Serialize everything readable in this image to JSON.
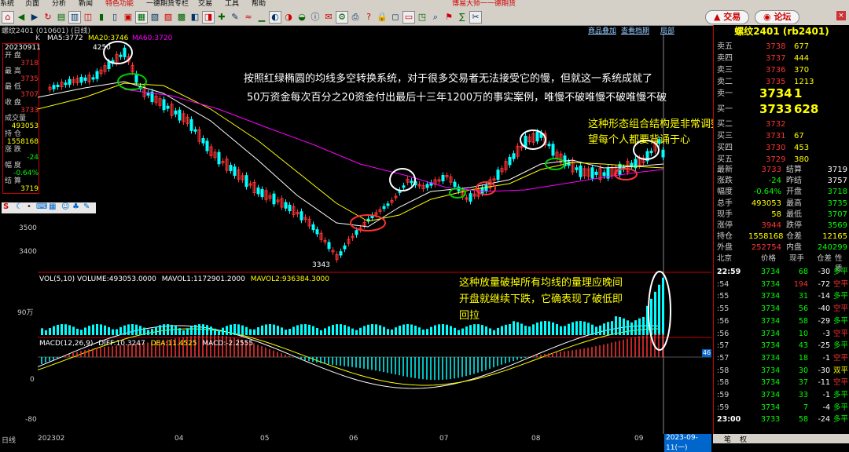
{
  "menu": {
    "items": [
      "系统",
      "页面",
      "分析",
      "新闻",
      "特色功能",
      "一德期货专栏",
      "交易",
      "工具",
      "帮助"
    ],
    "app_title": "博易大师一一德期货"
  },
  "toolbar": {
    "trade_label": "交易",
    "forum_label": "论坛",
    "icons": [
      "home-icon",
      "back-icon",
      "forward-icon",
      "refresh-icon",
      "quote-icon",
      "chart-icon",
      "minute-icon",
      "kline-icon",
      "f10-icon",
      "f11-icon",
      "grid-icon",
      "list-icon",
      "period-icon",
      "zoom-in-icon",
      "zoom-out-icon",
      "cross-icon",
      "draw-icon",
      "indicator-icon",
      "ma-icon",
      "vol-icon",
      "kdj-icon",
      "rsi-icon",
      "boll-icon",
      "info-icon",
      "news-icon",
      "settings-icon",
      "print-icon",
      "help-icon",
      "lock-icon",
      "unlock-icon",
      "window-icon",
      "split-icon",
      "search-icon",
      "alert-icon",
      "calc-icon",
      "tool-icon"
    ]
  },
  "chart_header": {
    "symbol_title": "螺纹2401 (010601) (日线)",
    "link1": "商品叠加",
    "link2": "查看档期",
    "link3": "局部"
  },
  "ma": {
    "k_label": "K",
    "ma5": "MA5:3772",
    "ma20": "MA20:3746",
    "ma60": "MA60:3720"
  },
  "left_panel": {
    "date": "20230911",
    "rows": [
      {
        "label": "开 盘",
        "value": "3718",
        "color": "red"
      },
      {
        "label": "最 高",
        "value": "3735",
        "color": "red"
      },
      {
        "label": "最 低",
        "value": "3707",
        "color": "red"
      },
      {
        "label": "收 盘",
        "value": "3733",
        "color": "red"
      },
      {
        "label": "成交量",
        "value": "493053",
        "color": "yellow"
      },
      {
        "label": "持 仓",
        "value": "1558168",
        "color": "yellow"
      },
      {
        "label": "涨 跌",
        "value": "-24",
        "color": "green"
      },
      {
        "label": "幅 度",
        "value": "-0.64%",
        "color": "green"
      },
      {
        "label": "结 算",
        "value": "3719",
        "color": "yellow"
      }
    ]
  },
  "price_axis": {
    "p1": "3500",
    "p2": "3400",
    "high_mark": "4250",
    "low_mark": "3343"
  },
  "annotations": {
    "line1": "按照红绿椭圆的均线多空转换系统，对于很多交易者无法接受它的慢，但就这一系统成就了",
    "line2": "50万资金每次百分之20资金付出最后十三年1200万的事实案例，唯慢不破唯慢不破唯慢不破",
    "pattern1": "这种形态组合结构是非常调整形态我提前指出，希",
    "pattern2": "望每个人都要背诵于心",
    "volume1": "这种放量破掉所有均线的量理应晚间",
    "volume2": "开盘就继续下跌，它确表现了破低即",
    "volume3": "回拉"
  },
  "volume": {
    "header": "VOL(5,10) VOLUME:493053.0000",
    "mavol1": "MAVOL1:1172901.2000",
    "mavol2": "MAVOL2:936384.3000",
    "axis": "90万"
  },
  "macd": {
    "header": "MACD(12,26,9)",
    "diff": "DIFF:10.3247",
    "dea": "DEA:11.4525",
    "macd": "MACD:-2.2555",
    "axis0": "0",
    "axis80": "-80",
    "badge": "46"
  },
  "x_axis": {
    "start": "日线",
    "labels": [
      "202302",
      "04",
      "05",
      "06",
      "07",
      "08",
      "09"
    ],
    "date_badge": "2023-09-11(一)"
  },
  "right_panel": {
    "title": "螺纹2401 (rb2401)",
    "asks": [
      {
        "label": "卖五",
        "price": "3738",
        "vol": "677"
      },
      {
        "label": "卖四",
        "price": "3737",
        "vol": "444"
      },
      {
        "label": "卖三",
        "price": "3736",
        "vol": "370"
      },
      {
        "label": "卖二",
        "price": "3735",
        "vol": "1213"
      },
      {
        "label": "卖一",
        "price": "3734",
        "vol": "1"
      }
    ],
    "bids": [
      {
        "label": "买一",
        "price": "3733",
        "vol": "628"
      },
      {
        "label": "买二",
        "price": "3732",
        "vol": ""
      },
      {
        "label": "买三",
        "price": "3731",
        "vol": "67"
      },
      {
        "label": "买四",
        "price": "3730",
        "vol": "453"
      },
      {
        "label": "买五",
        "price": "3729",
        "vol": "380"
      }
    ],
    "stats": [
      {
        "l1": "最新",
        "v1": "3733",
        "c1": "red",
        "l2": "结算",
        "v2": "3719",
        "c2": "white"
      },
      {
        "l1": "涨跌",
        "v1": "-24",
        "c1": "green",
        "l2": "昨结",
        "v2": "3757",
        "c2": "white"
      },
      {
        "l1": "幅度",
        "v1": "-0.64%",
        "c1": "green",
        "l2": "开盘",
        "v2": "3718",
        "c2": "green"
      },
      {
        "l1": "总手",
        "v1": "493053",
        "c1": "yellow",
        "l2": "最高",
        "v2": "3735",
        "c2": "green"
      },
      {
        "l1": "现手",
        "v1": "58",
        "c1": "yellow",
        "l2": "最低",
        "v2": "3707",
        "c2": "green"
      },
      {
        "l1": "涨停",
        "v1": "3944",
        "c1": "red",
        "l2": "跌停",
        "v2": "3569",
        "c2": "green"
      },
      {
        "l1": "持仓",
        "v1": "1558168",
        "c1": "yellow",
        "l2": "仓差",
        "v2": "12165",
        "c2": "yellow"
      },
      {
        "l1": "外盘",
        "v1": "252754",
        "c1": "red",
        "l2": "内盘",
        "v2": "240299",
        "c2": "green"
      }
    ],
    "tick_header": {
      "time": "北京",
      "price": "价格",
      "vol": "现手",
      "oi": "仓差",
      "nature": "性质"
    },
    "ticks": [
      {
        "t": "22:59",
        "p": "3734",
        "v": "68",
        "oi": "-30",
        "n": "多平",
        "nc": "green"
      },
      {
        "t": ":54",
        "p": "3734",
        "v": "194",
        "oi": "-72",
        "n": "空平",
        "nc": "red"
      },
      {
        "t": ":55",
        "p": "3734",
        "v": "31",
        "oi": "-14",
        "n": "多平",
        "nc": "green"
      },
      {
        "t": ":55",
        "p": "3734",
        "v": "56",
        "oi": "-40",
        "n": "空平",
        "nc": "red"
      },
      {
        "t": ":56",
        "p": "3734",
        "v": "58",
        "oi": "-29",
        "n": "多平",
        "nc": "green"
      },
      {
        "t": ":56",
        "p": "3734",
        "v": "10",
        "oi": "-3",
        "n": "空平",
        "nc": "red"
      },
      {
        "t": ":57",
        "p": "3734",
        "v": "43",
        "oi": "-25",
        "n": "多平",
        "nc": "green"
      },
      {
        "t": ":57",
        "p": "3734",
        "v": "18",
        "oi": "-1",
        "n": "空平",
        "nc": "red"
      },
      {
        "t": ":58",
        "p": "3734",
        "v": "30",
        "oi": "-30",
        "n": "双平",
        "nc": "yellow"
      },
      {
        "t": ":58",
        "p": "3734",
        "v": "37",
        "oi": "-11",
        "n": "空平",
        "nc": "red"
      },
      {
        "t": ":59",
        "p": "3734",
        "v": "33",
        "oi": "-1",
        "n": "多平",
        "nc": "green"
      },
      {
        "t": ":59",
        "p": "3734",
        "v": "7",
        "oi": "-4",
        "n": "多平",
        "nc": "green"
      },
      {
        "t": "23:00",
        "p": "3733",
        "v": "58",
        "oi": "-24",
        "n": "多平",
        "nc": "green"
      }
    ],
    "tab1": "笔",
    "tab2": "权"
  }
}
